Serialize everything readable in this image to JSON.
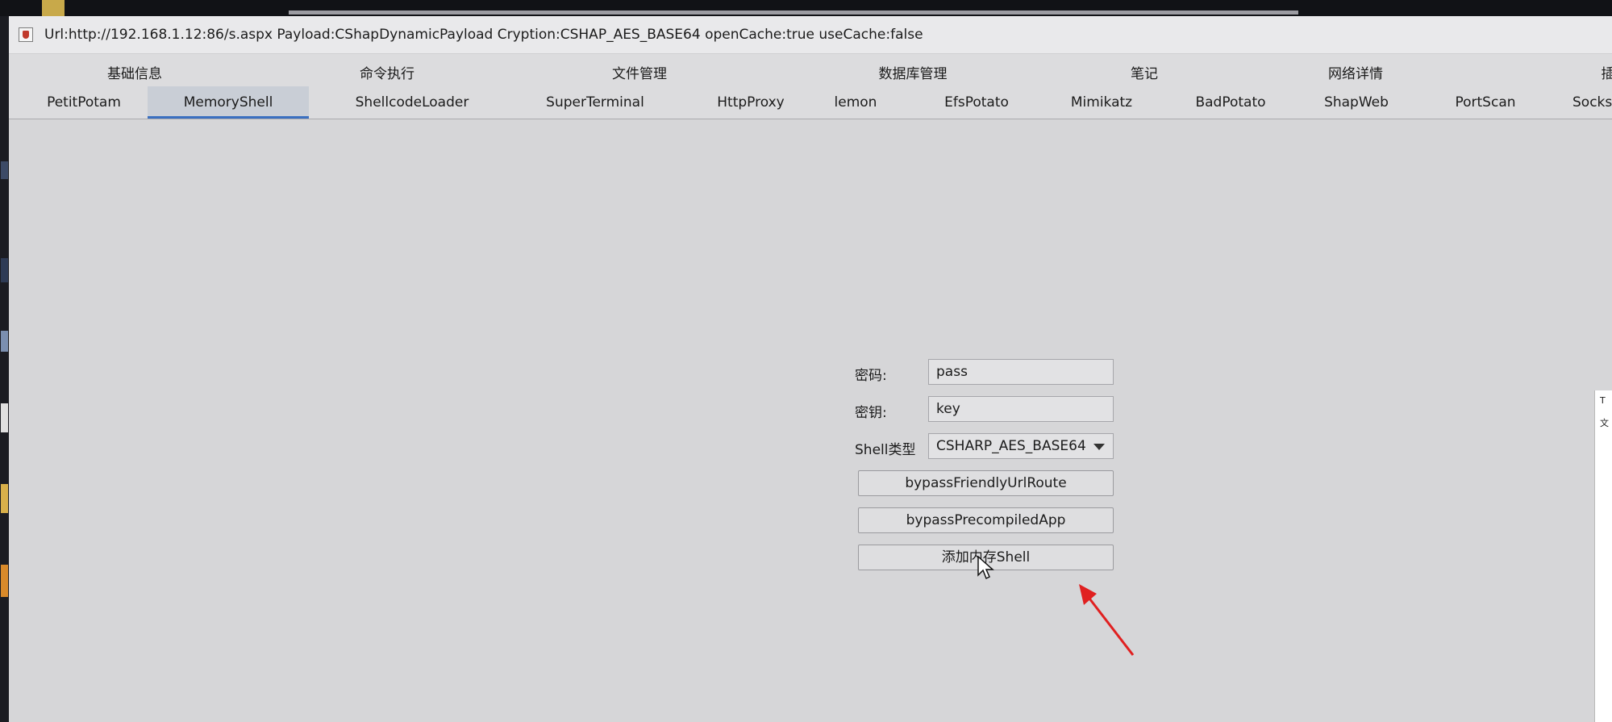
{
  "window": {
    "title": "Url:http://192.168.1.12:86/s.aspx Payload:CShapDynamicPayload Cryption:CSHAP_AES_BASE64 openCache:true useCache:false"
  },
  "tabs_primary": [
    {
      "label": "基础信息"
    },
    {
      "label": "命令执行"
    },
    {
      "label": "文件管理"
    },
    {
      "label": "数据库管理"
    },
    {
      "label": "笔记"
    },
    {
      "label": "网络详情"
    },
    {
      "label": "插"
    }
  ],
  "tabs_secondary": [
    {
      "label": "PetitPotam"
    },
    {
      "label": "MemoryShell",
      "active": true
    },
    {
      "label": "ShellcodeLoader"
    },
    {
      "label": "SuperTerminal"
    },
    {
      "label": "HttpProxy"
    },
    {
      "label": "lemon"
    },
    {
      "label": "EfsPotato"
    },
    {
      "label": "Mimikatz"
    },
    {
      "label": "BadPotato"
    },
    {
      "label": "ShapWeb"
    },
    {
      "label": "PortScan"
    },
    {
      "label": "Socks"
    }
  ],
  "form": {
    "password_label": "密码:",
    "password_value": "pass",
    "key_label": "密钥:",
    "key_value": "key",
    "shell_type_label": "Shell类型",
    "shell_type_value": "CSHARP_AES_BASE64",
    "bypass_friendly_label": "bypassFriendlyUrlRoute",
    "bypass_precompiled_label": "bypassPrecompiledApp",
    "add_shell_label": "添加内存Shell"
  },
  "side_popup": {
    "line1": "T",
    "line2": "文"
  },
  "colors": {
    "active_tab_underline": "#3a6fc0",
    "annotation_arrow": "#e02020"
  }
}
